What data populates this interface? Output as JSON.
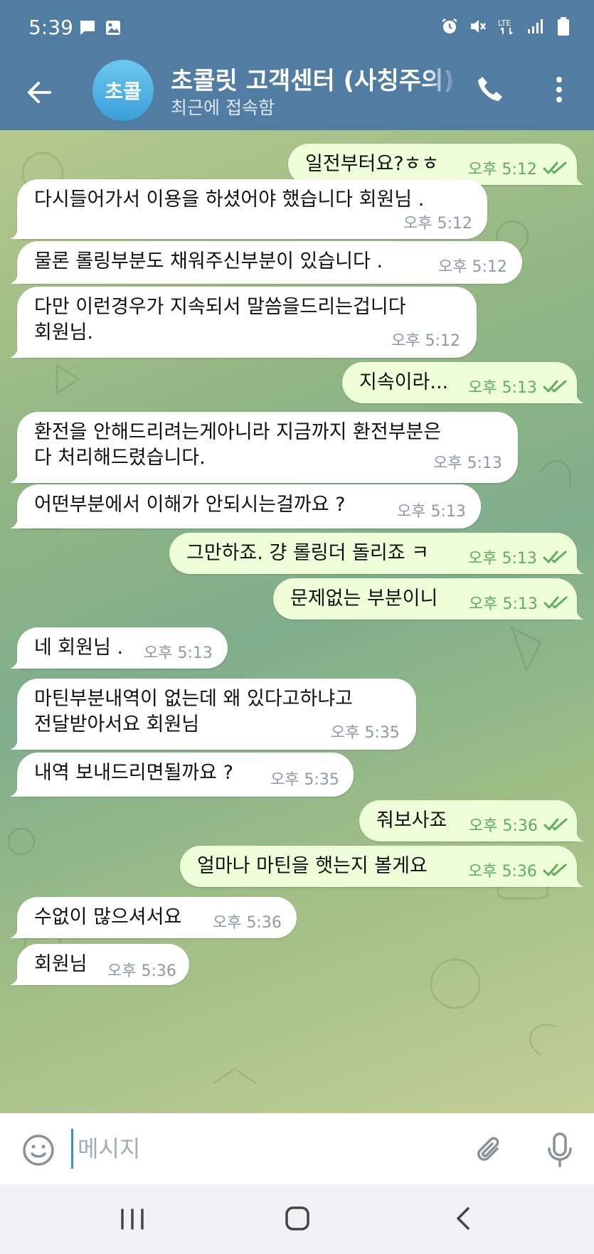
{
  "status_bar": {
    "time": "5:39",
    "left_icons": [
      "message-icon",
      "image-icon"
    ],
    "right_icons": [
      "alarm-icon",
      "mute-icon",
      "lte-icon",
      "signal-icon",
      "battery-icon"
    ],
    "network": "LTE"
  },
  "header": {
    "avatar_text": "초콜",
    "title": "초콜릿 고객센터 (사칭주의)",
    "status": "최근에 접속함"
  },
  "messages": [
    {
      "dir": "out",
      "text": "일전부터요?ㅎㅎ",
      "time": "오후 5:12",
      "read": true
    },
    {
      "dir": "in",
      "text": "다시들어가서 이용을 하셨어야 했습니다 회원님 .",
      "time": "오후 5:12"
    },
    {
      "dir": "in",
      "text": "물론 롤링부분도 채워주신부분이 있습니다 .",
      "time": "오후 5:12"
    },
    {
      "dir": "in",
      "text": "다만 이런경우가 지속되서 말씀을드리는겁니다",
      "text2": "회원님.",
      "time": "오후 5:12"
    },
    {
      "dir": "out",
      "text": "지속이라...",
      "time": "오후 5:13",
      "read": true
    },
    {
      "dir": "in",
      "text": "환전을 안해드리려는게아니라 지금까지 환전부분은",
      "text2": "다 처리해드렸습니다.",
      "time": "오후 5:13"
    },
    {
      "dir": "in",
      "text": "어떤부분에서 이해가 안되시는걸까요 ?",
      "time": "오후 5:13"
    },
    {
      "dir": "out",
      "text": "그만하죠. 걍 롤링더 돌리죠 ㅋ",
      "time": "오후 5:13",
      "read": true
    },
    {
      "dir": "out",
      "text": "문제없는 부분이니",
      "time": "오후 5:13",
      "read": true
    },
    {
      "dir": "in",
      "text": "네 회원님 .",
      "time": "오후 5:13"
    },
    {
      "dir": "in",
      "text": "마틴부분내역이 없는데 왜 있다고하냐고",
      "text2": "전달받아서요 회원님",
      "time": "오후 5:35"
    },
    {
      "dir": "in",
      "text": "내역 보내드리면될까요 ?",
      "time": "오후 5:35"
    },
    {
      "dir": "out",
      "text": "줘보사죠",
      "time": "오후 5:36",
      "read": true
    },
    {
      "dir": "out",
      "text": "얼마나 마틴을 햇는지 볼게요",
      "time": "오후 5:36",
      "read": true
    },
    {
      "dir": "in",
      "text": "수없이 많으셔서요",
      "time": "오후 5:36"
    },
    {
      "dir": "in",
      "text": "회원님",
      "time": "오후 5:36"
    }
  ],
  "input": {
    "placeholder": "메시지"
  },
  "icons": {
    "back": "arrow-left-icon",
    "call": "phone-icon",
    "menu": "more-vert-icon",
    "emoji": "emoji-icon",
    "attach": "paperclip-icon",
    "mic": "microphone-icon",
    "nav": [
      "recents-icon",
      "home-icon",
      "nav-back-icon"
    ],
    "read_receipt": "double-check-icon"
  },
  "colors": {
    "header": "#517da2",
    "incoming_bubble": "#ffffff",
    "outgoing_bubble": "#eefed8",
    "outgoing_meta": "#5fad5e",
    "incoming_meta": "#8e9aa4",
    "avatar": "#3a9fd8"
  }
}
